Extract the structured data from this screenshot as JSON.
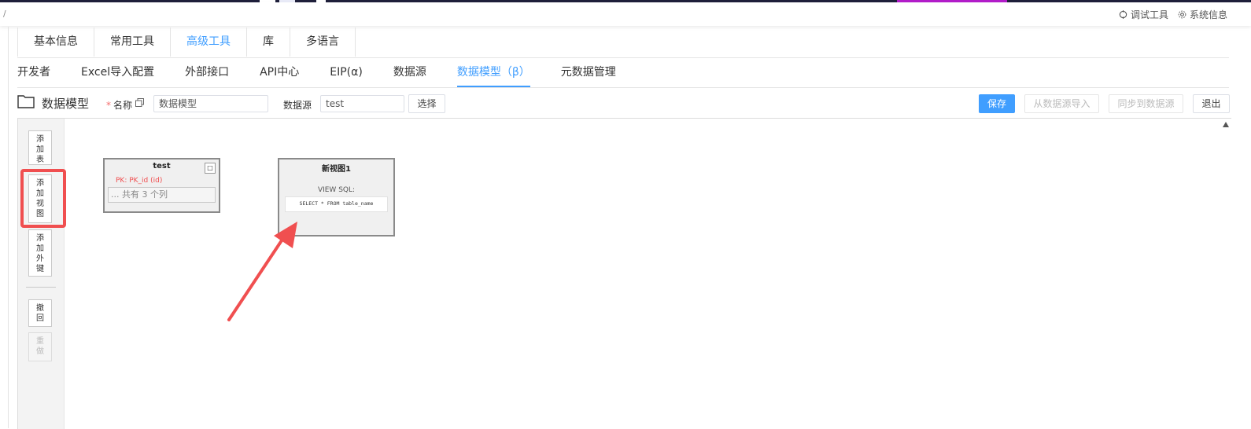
{
  "header": {
    "breadcrumb": "/",
    "debug_tools": "调试工具",
    "system_info": "系统信息"
  },
  "tabs_primary": [
    {
      "label": "基本信息",
      "active": false
    },
    {
      "label": "常用工具",
      "active": false
    },
    {
      "label": "高级工具",
      "active": true
    },
    {
      "label": "库",
      "active": false
    },
    {
      "label": "多语言",
      "active": false
    }
  ],
  "tabs_secondary": [
    {
      "label": "开发者",
      "active": false
    },
    {
      "label": "Excel导入配置",
      "active": false
    },
    {
      "label": "外部接口",
      "active": false
    },
    {
      "label": "API中心",
      "active": false
    },
    {
      "label": "EIP(α)",
      "active": false
    },
    {
      "label": "数据源",
      "active": false
    },
    {
      "label": "数据模型（β）",
      "active": true
    },
    {
      "label": "元数据管理",
      "active": false
    }
  ],
  "toolbar": {
    "title": "数据模型",
    "name_required_mark": "*",
    "name_label": "名称",
    "name_value": "数据模型",
    "datasource_label": "数据源",
    "datasource_value": "test",
    "select_button": "选择",
    "save_button": "保存",
    "import_button": "从数据源导入",
    "sync_button": "同步到数据源",
    "exit_button": "退出"
  },
  "side_tools": {
    "add_table": "添加表",
    "add_view": "添加视图",
    "add_fk": "添加外键",
    "undo": "撤回",
    "redo": "重做"
  },
  "nodes": {
    "table": {
      "title": "test",
      "toggle": "□",
      "pk": "PK: PK_id (id)",
      "column_summary": "... 共有 3 个列"
    },
    "view": {
      "title": "新视图1",
      "sql_label": "VIEW SQL:",
      "sql": "SELECT * FROM table_name"
    }
  },
  "colors": {
    "accent": "#409eff",
    "highlight": "#f04f50",
    "pk_text": "#f04f50"
  }
}
